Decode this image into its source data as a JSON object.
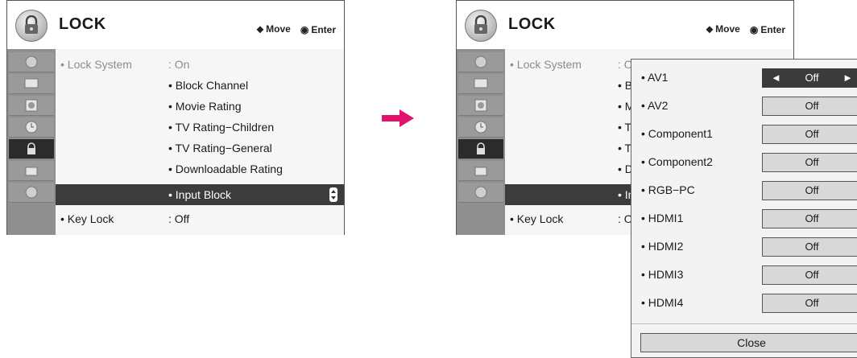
{
  "left_panel": {
    "title": "LOCK",
    "hint_move": "Move",
    "hint_enter": "Enter",
    "rows": {
      "lock_system_label": "• Lock System",
      "lock_system_value": ": On",
      "block_channel": "• Block Channel",
      "movie_rating": "• Movie Rating",
      "tv_children": "• TV Rating−Children",
      "tv_general": "• TV Rating−General",
      "downloadable": "• Downloadable Rating",
      "input_block": "• Input Block",
      "key_lock_label": "• Key Lock",
      "key_lock_value": ": Off"
    }
  },
  "right_panel": {
    "title": "LOCK",
    "hint_move": "Move",
    "hint_enter": "Enter",
    "lock_system_label": "• Lock System",
    "lock_system_value_partial": ": O",
    "partial_rows": [
      "• B",
      "• M",
      "• T",
      "• T",
      "• D",
      "• In"
    ],
    "key_lock_label": "• Key Lock",
    "key_lock_value_partial": ": O"
  },
  "popup": {
    "items": [
      {
        "label": "• AV1",
        "value": "Off"
      },
      {
        "label": "• AV2",
        "value": "Off"
      },
      {
        "label": "• Component1",
        "value": "Off"
      },
      {
        "label": "• Component2",
        "value": "Off"
      },
      {
        "label": "• RGB−PC",
        "value": "Off"
      },
      {
        "label": "• HDMI1",
        "value": "Off"
      },
      {
        "label": "• HDMI2",
        "value": "Off"
      },
      {
        "label": "• HDMI3",
        "value": "Off"
      },
      {
        "label": "• HDMI4",
        "value": "Off"
      }
    ],
    "close_label": "Close",
    "left_arrow": "◄",
    "right_arrow": "►"
  },
  "icons": {
    "move_icon": "⬥",
    "enter_icon": "◉",
    "transition_arrow": "right-arrow-icon"
  },
  "colors": {
    "arrow": "#e2126a",
    "selected_row": "#3c3c3c",
    "sidebar": "#8f8f8f"
  }
}
